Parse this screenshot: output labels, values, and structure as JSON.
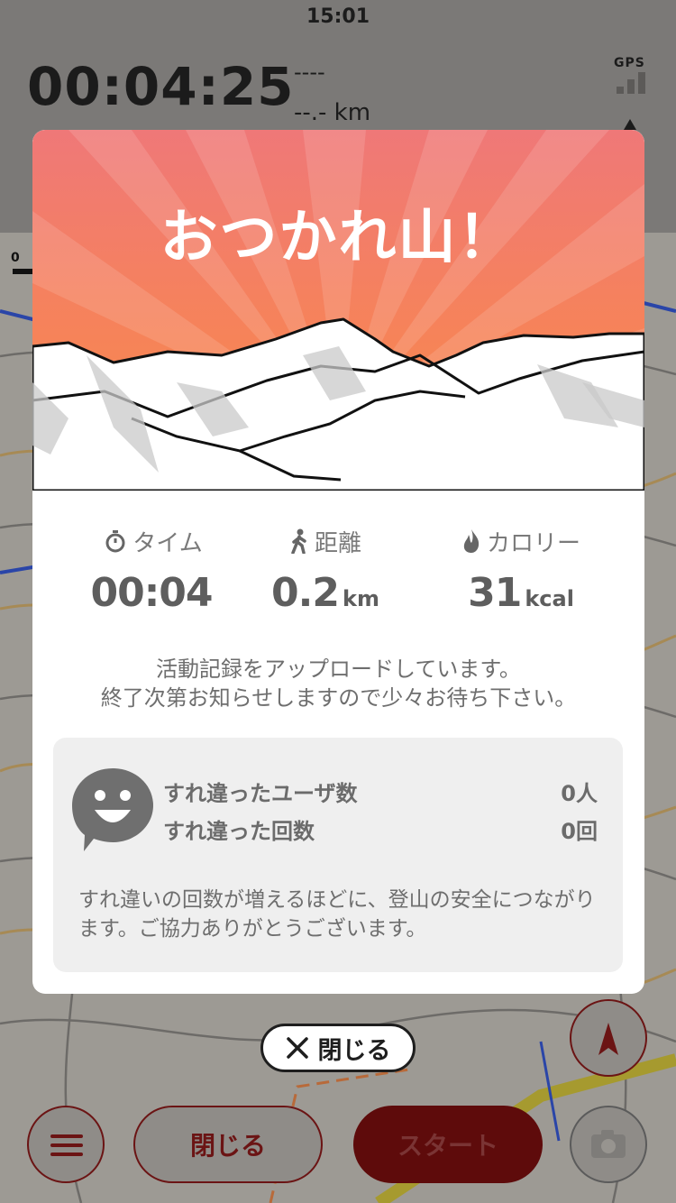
{
  "status": {
    "time": "15:01"
  },
  "tracker": {
    "elapsed": "00:04:25",
    "pace": "----",
    "distance": "--.- km",
    "gps_label": "GPS",
    "scale_zero": "0"
  },
  "controls": {
    "close_label": "閉じる",
    "start_label": "スタート"
  },
  "modal": {
    "title": "おつかれ山！",
    "stats": [
      {
        "icon": "stopwatch-icon",
        "label": "タイム",
        "value": "00:04",
        "unit": ""
      },
      {
        "icon": "walker-icon",
        "label": "距離",
        "value": "0.2",
        "unit": "km"
      },
      {
        "icon": "flame-icon",
        "label": "カロリー",
        "value": "31",
        "unit": "kcal"
      }
    ],
    "upload_line1": "活動記録をアップロードしています。",
    "upload_line2": "終了次第お知らせしますので少々お待ち下さい。",
    "encounter": {
      "users_label": "すれ違ったユーザ数",
      "users_value": "0人",
      "count_label": "すれ違った回数",
      "count_value": "0回",
      "note": "すれ違いの回数が増えるほどに、登山の安全につながります。ご協力ありがとうございます。"
    },
    "close_button": "閉じる"
  },
  "colors": {
    "hero_top": "#ef7878",
    "hero_bottom": "#f98a45",
    "accent_dark_red": "#6b1414"
  }
}
